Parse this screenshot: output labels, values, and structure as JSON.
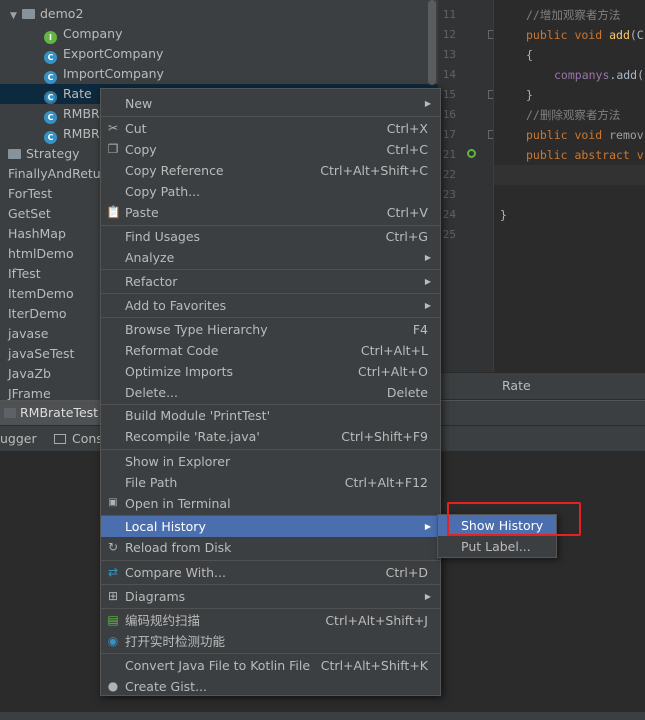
{
  "project_tree": {
    "items": [
      {
        "label": "demo2",
        "icon": "folder-icon",
        "arrow": "▼"
      },
      {
        "label": "Company",
        "icon": "interface-icon",
        "glyph": "I"
      },
      {
        "label": "ExportCompany",
        "icon": "class-icon",
        "glyph": "C"
      },
      {
        "label": "ImportCompany",
        "icon": "class-icon",
        "glyph": "C"
      },
      {
        "label": "Rate",
        "icon": "abstract-class-icon",
        "glyph": "C"
      },
      {
        "label": "RMBRa",
        "icon": "class-icon",
        "glyph": "C"
      },
      {
        "label": "RMBRa",
        "icon": "class-icon",
        "glyph": "C"
      },
      {
        "label": "Strategy",
        "icon": "folder-icon"
      },
      {
        "label": "FinallyAndReturn",
        "icon": "folder-icon"
      },
      {
        "label": "ForTest",
        "icon": "folder-icon"
      },
      {
        "label": "GetSet",
        "icon": "folder-icon"
      },
      {
        "label": "HashMap",
        "icon": "folder-icon"
      },
      {
        "label": "htmlDemo",
        "icon": "folder-icon"
      },
      {
        "label": "IfTest",
        "icon": "folder-icon"
      },
      {
        "label": "ItemDemo",
        "icon": "folder-icon"
      },
      {
        "label": "IterDemo",
        "icon": "folder-icon"
      },
      {
        "label": "javase",
        "icon": "folder-icon"
      },
      {
        "label": "javaSeTest",
        "icon": "folder-icon"
      },
      {
        "label": "JavaZb",
        "icon": "folder-icon"
      },
      {
        "label": "JFrame",
        "icon": "folder-icon"
      }
    ]
  },
  "editor": {
    "line_numbers": [
      "11",
      "12",
      "13",
      "14",
      "15",
      "16",
      "17",
      "21",
      "22",
      "23",
      "24",
      "25"
    ],
    "code": {
      "l11_comment": "//增加观察者方法",
      "l12_kw": "public void ",
      "l12_fn": "add",
      "l12_rest": "(C",
      "l13": "{",
      "l14_fld": "companys",
      "l14_rest": ".add(",
      "l15": "}",
      "l16_comment": "//删除观察者方法",
      "l17_kw": "public void ",
      "l17_rest": "remov",
      "l21_kw": "public abstract v",
      "l24": "}"
    },
    "tab_label": "Rate"
  },
  "run_bar": {
    "tab_label": "RMBrateTest"
  },
  "console_bar": {
    "debugger_label": "ugger",
    "console_label": "Conso"
  },
  "context_menu": {
    "items": [
      {
        "label": "New",
        "shortcut": "",
        "submenu": true,
        "icon": ""
      },
      {
        "label": "Cut",
        "shortcut": "Ctrl+X",
        "icon": "scissors-icon"
      },
      {
        "label": "Copy",
        "shortcut": "Ctrl+C",
        "icon": "copy-icon"
      },
      {
        "label": "Copy Reference",
        "shortcut": "Ctrl+Alt+Shift+C"
      },
      {
        "label": "Copy Path...",
        "shortcut": ""
      },
      {
        "label": "Paste",
        "shortcut": "Ctrl+V",
        "icon": "paste-icon"
      },
      {
        "label": "Find Usages",
        "shortcut": "Ctrl+G"
      },
      {
        "label": "Analyze",
        "shortcut": "",
        "submenu": true
      },
      {
        "label": "Refactor",
        "shortcut": "",
        "submenu": true
      },
      {
        "label": "Add to Favorites",
        "shortcut": "",
        "submenu": true
      },
      {
        "label": "Browse Type Hierarchy",
        "shortcut": "F4"
      },
      {
        "label": "Reformat Code",
        "shortcut": "Ctrl+Alt+L"
      },
      {
        "label": "Optimize Imports",
        "shortcut": "Ctrl+Alt+O"
      },
      {
        "label": "Delete...",
        "shortcut": "Delete"
      },
      {
        "label": "Build Module 'PrintTest'",
        "shortcut": ""
      },
      {
        "label": "Recompile 'Rate.java'",
        "shortcut": "Ctrl+Shift+F9"
      },
      {
        "label": "Show in Explorer",
        "shortcut": ""
      },
      {
        "label": "File Path",
        "shortcut": "Ctrl+Alt+F12"
      },
      {
        "label": "Open in Terminal",
        "shortcut": "",
        "icon": "terminal-icon"
      },
      {
        "label": "Local History",
        "shortcut": "",
        "submenu": true,
        "highlighted": true
      },
      {
        "label": "Reload from Disk",
        "shortcut": "",
        "icon": "reload-icon"
      },
      {
        "label": "Compare With...",
        "shortcut": "Ctrl+D",
        "icon": "compare-icon"
      },
      {
        "label": "Diagrams",
        "shortcut": "",
        "submenu": true,
        "icon": "diagram-icon"
      },
      {
        "label": "编码规约扫描",
        "shortcut": "Ctrl+Alt+Shift+J",
        "icon": "scan-icon"
      },
      {
        "label": "打开实时检测功能",
        "shortcut": "",
        "icon": "realtime-check-icon"
      },
      {
        "label": "Convert Java File to Kotlin File",
        "shortcut": "Ctrl+Alt+Shift+K"
      },
      {
        "label": "Create Gist...",
        "shortcut": "",
        "icon": "github-icon"
      }
    ]
  },
  "submenu": {
    "items": [
      {
        "label": "Show History",
        "highlighted": true
      },
      {
        "label": "Put Label..."
      }
    ]
  },
  "colors": {
    "menu_bg": "#3c3f41",
    "highlight": "#4b6eaf",
    "annotation_box": "#e52121"
  }
}
